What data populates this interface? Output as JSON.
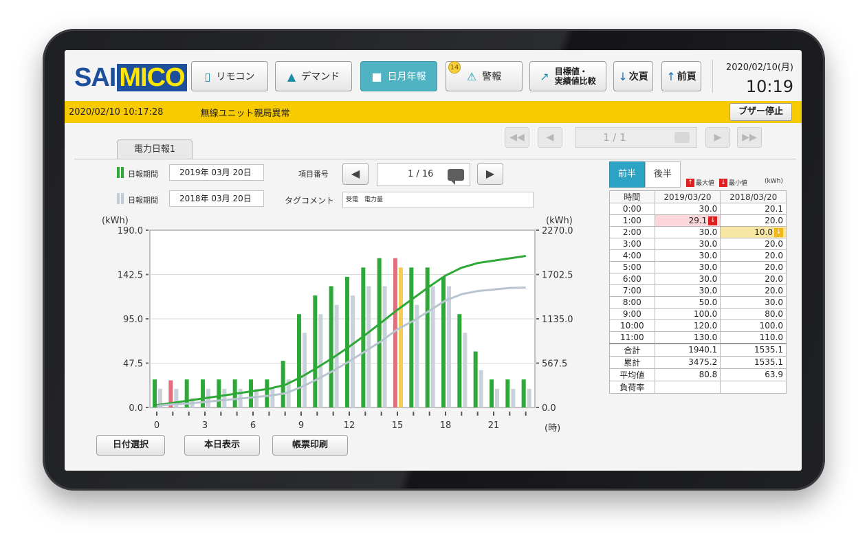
{
  "header": {
    "logo_part1": "SAI",
    "logo_part2": "MICO",
    "nav": [
      {
        "label": "リモコン",
        "icon": "remote-icon"
      },
      {
        "label": "デマンド",
        "icon": "demand-chart-icon"
      },
      {
        "label": "日月年報",
        "icon": "report-icon",
        "active": true
      },
      {
        "label": "警報",
        "icon": "warning-icon",
        "badge": "14"
      },
      {
        "label_line1": "目標値・",
        "label_line2": "実績値比較",
        "icon": "trend-icon"
      },
      {
        "label": "次頁",
        "icon": "arrow-down-icon"
      },
      {
        "label": "前頁",
        "icon": "arrow-up-icon"
      }
    ],
    "date": "2020/02/10(月)",
    "time": "10:19"
  },
  "alarm": {
    "timestamp": "2020/02/10 10:17:28",
    "message": "無線ユニット親局異常",
    "buzzer_label": "ブザー停止",
    "color": "#f8ca00"
  },
  "pager": {
    "value": "1 / 1"
  },
  "tab": {
    "label": "電力日報1"
  },
  "form": {
    "period1_label": "日報期間",
    "period1_value": "2019年 03月 20日",
    "period2_label": "日報期間",
    "period2_value": "2018年 03月 20日",
    "item_no_label": "項目番号",
    "item_no_value": "1 / 16",
    "tag_comment_label": "タグコメント",
    "tag_comment_value": "受電　電力量"
  },
  "chart_data": {
    "type": "bar",
    "ylabel_left": "(kWh)",
    "ylabel_right": "(kWh)",
    "xlabel": "(時)",
    "y_ticks_left": [
      "190.0",
      "142.5",
      "95.0",
      "47.5",
      "0.0"
    ],
    "y_ticks_right": [
      "2270.0",
      "1702.5",
      "1135.0",
      "567.5",
      "0.0"
    ],
    "ylim_left": [
      0,
      190
    ],
    "ylim_right": [
      0,
      2270
    ],
    "x_ticks": [
      "0",
      "3",
      "6",
      "9",
      "12",
      "15",
      "18",
      "21"
    ],
    "categories": [
      0,
      1,
      2,
      3,
      4,
      5,
      6,
      7,
      8,
      9,
      10,
      11,
      12,
      13,
      14,
      15,
      16,
      17,
      18,
      19,
      20,
      21,
      22,
      23
    ],
    "series": [
      {
        "values": [
          30,
          29.1,
          30,
          30,
          30,
          30,
          30,
          30,
          50,
          100,
          120,
          130,
          140,
          150,
          160,
          160,
          150,
          150,
          140,
          100,
          60,
          30,
          30,
          30
        ],
        "color": "#2ea836"
      },
      {
        "values": [
          20.1,
          20,
          10,
          20,
          20,
          20,
          20,
          20,
          30,
          80,
          100,
          110,
          120,
          130,
          130,
          150,
          110,
          130,
          130,
          80,
          40,
          20,
          20,
          20
        ],
        "color": "#c9d2db"
      }
    ],
    "bar_highlight": {
      "max_color": "#e2707e",
      "min_color": "#f3cf5a",
      "max_index": 15,
      "min_index": 1,
      "min2_index": 15
    },
    "cumulative": [
      {
        "values": [
          30,
          59.1,
          89.1,
          119.1,
          149.1,
          179.1,
          209.1,
          239.1,
          289.1,
          389.1,
          509.1,
          639.1,
          779.1,
          929.1,
          1089.1,
          1249.1,
          1399.1,
          1549.1,
          1689.1,
          1789.1,
          1849.1,
          1879.1,
          1909.1,
          1940.1
        ],
        "color": "#2ea836"
      },
      {
        "values": [
          20.1,
          40.1,
          50.1,
          70.1,
          90.1,
          110.1,
          130.1,
          150.1,
          180.1,
          260.1,
          360.1,
          470.1,
          590.1,
          720.1,
          850.1,
          1000.1,
          1110.1,
          1240.1,
          1370.1,
          1450.1,
          1490.1,
          1510.1,
          1530.1,
          1535.1
        ],
        "color": "#b8c4cf"
      }
    ]
  },
  "buttons": {
    "date_select": "日付選択",
    "today": "本日表示",
    "print": "帳票印刷"
  },
  "table": {
    "first_half": "前半",
    "second_half": "後半",
    "max_label": "最大値",
    "min_label": "最小値",
    "unit": "(kWh)",
    "headers": [
      "時間",
      "2019/03/20",
      "2018/03/20"
    ],
    "rows": [
      [
        "0:00",
        "30.0",
        "20.1"
      ],
      [
        "1:00",
        "29.1",
        "20.0"
      ],
      [
        "2:00",
        "30.0",
        "10.0"
      ],
      [
        "3:00",
        "30.0",
        "20.0"
      ],
      [
        "4:00",
        "30.0",
        "20.0"
      ],
      [
        "5:00",
        "30.0",
        "20.0"
      ],
      [
        "6:00",
        "30.0",
        "20.0"
      ],
      [
        "7:00",
        "30.0",
        "20.0"
      ],
      [
        "8:00",
        "50.0",
        "30.0"
      ],
      [
        "9:00",
        "100.0",
        "80.0"
      ],
      [
        "10:00",
        "120.0",
        "100.0"
      ],
      [
        "11:00",
        "130.0",
        "110.0"
      ]
    ],
    "summary": [
      [
        "合計",
        "1940.1",
        "1535.1"
      ],
      [
        "累計",
        "3475.2",
        "1535.1"
      ],
      [
        "平均値",
        "80.8",
        "63.9"
      ],
      [
        "負荷率",
        "",
        ""
      ]
    ]
  }
}
